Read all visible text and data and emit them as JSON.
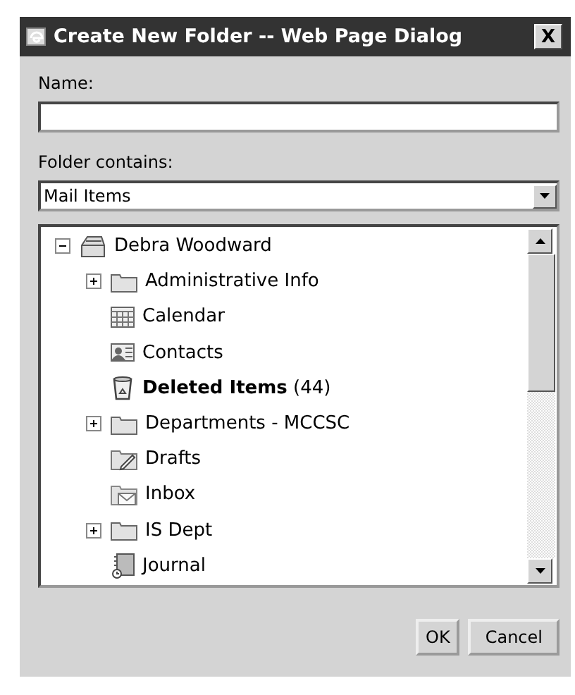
{
  "window": {
    "title": "Create New Folder -- Web Page Dialog",
    "close": "X"
  },
  "name_field": {
    "label": "Name:"
  },
  "contains_field": {
    "label": "Folder contains:",
    "value": "Mail Items"
  },
  "tree": [
    {
      "label": "Debra Woodward",
      "kind": "mailbox",
      "expanded": true,
      "children": [
        {
          "label": "Administrative Info",
          "kind": "folder",
          "expanded": false
        },
        {
          "label": "Calendar",
          "kind": "calendar"
        },
        {
          "label": "Contacts",
          "kind": "contacts"
        },
        {
          "label": "**Deleted Items** (44)",
          "kind": "deleted"
        },
        {
          "label": "Departments - MCCSC",
          "kind": "folder",
          "expanded": false
        },
        {
          "label": "Drafts",
          "kind": "drafts"
        },
        {
          "label": "Inbox",
          "kind": "inbox"
        },
        {
          "label": "IS Dept",
          "kind": "folder",
          "expanded": false
        },
        {
          "label": "Journal",
          "kind": "journal"
        }
      ]
    }
  ],
  "buttons": [
    "OK",
    "Cancel"
  ]
}
